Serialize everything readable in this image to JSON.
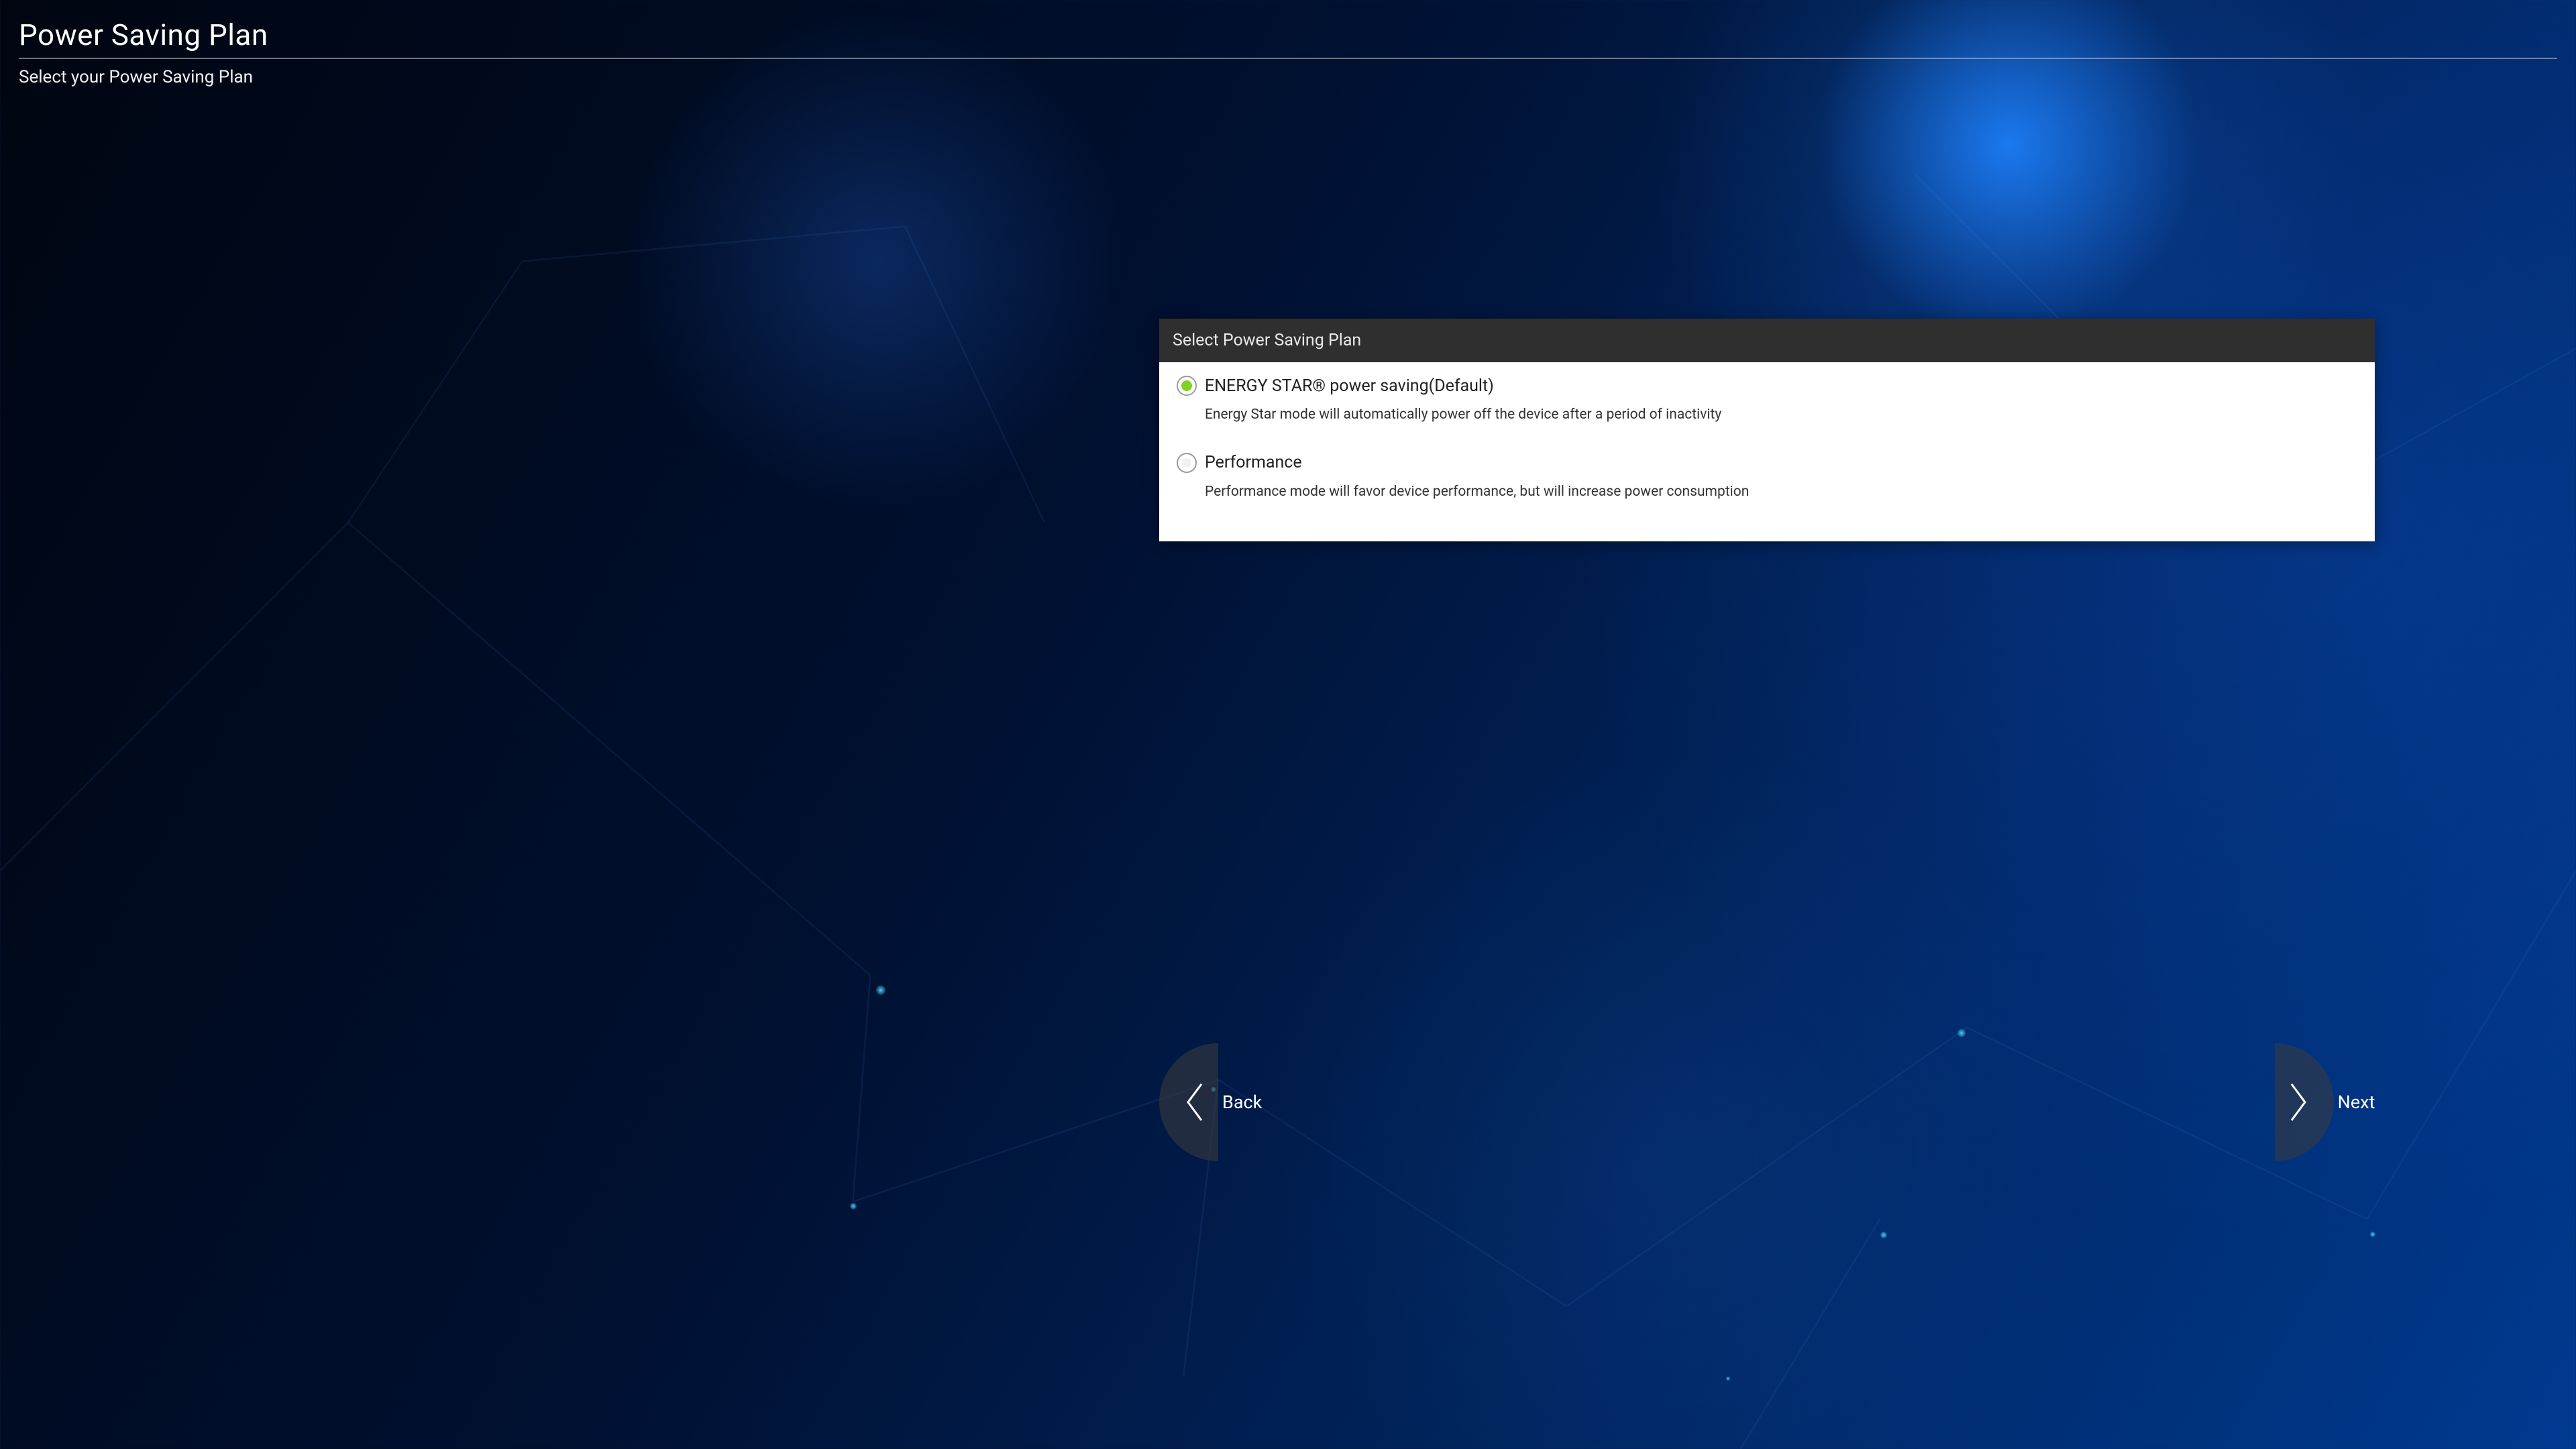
{
  "page": {
    "title": "Power Saving Plan",
    "subtitle": "Select your Power Saving Plan"
  },
  "card": {
    "header": "Select Power Saving Plan",
    "options": [
      {
        "label": "ENERGY STAR® power saving(Default)",
        "description": "Energy Star mode will automatically power off the device after a period of inactivity",
        "selected": true
      },
      {
        "label": "Performance",
        "description": "Performance mode will favor device performance, but will increase power consumption",
        "selected": false
      }
    ]
  },
  "nav": {
    "back": "Back",
    "next": "Next"
  },
  "colors": {
    "accent_selected": "#7ed321",
    "card_header_bg": "#2f2f2f",
    "card_bg": "#ffffff"
  }
}
